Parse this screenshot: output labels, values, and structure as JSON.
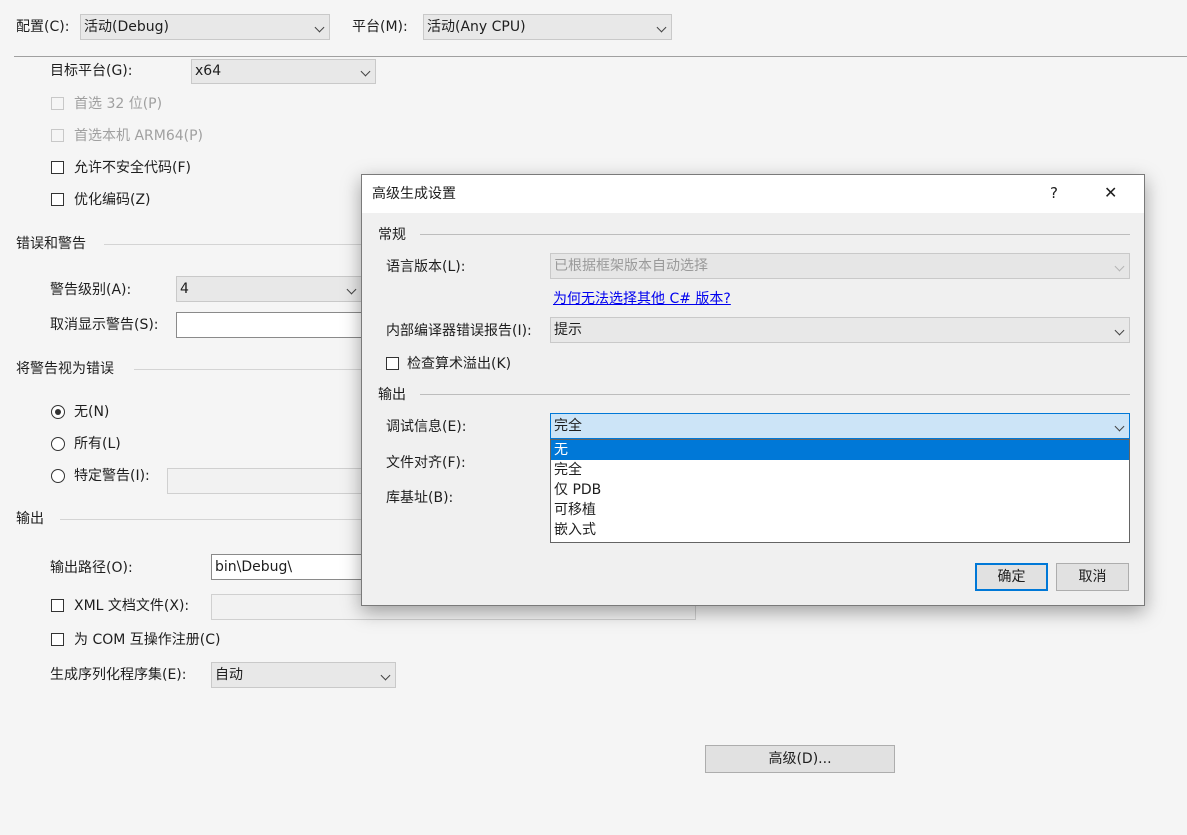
{
  "top": {
    "config_label": "配置(C):",
    "config_value": "活动(Debug)",
    "platform_label": "平台(M):",
    "platform_value": "活动(Any CPU)"
  },
  "general": {
    "target_platform_label": "目标平台(G):",
    "target_platform_value": "x64",
    "prefer32_label": "首选 32 位(P)",
    "prefer_arm64_label": "首选本机 ARM64(P)",
    "unsafe_label": "允许不安全代码(F)",
    "optimize_label": "优化编码(Z)"
  },
  "errors": {
    "section_title": "错误和警告",
    "warning_level_label": "警告级别(A):",
    "warning_level_value": "4",
    "suppress_label": "取消显示警告(S):",
    "suppress_value": ""
  },
  "treat_warnings": {
    "section_title": "将警告视为错误",
    "none_label": "无(N)",
    "all_label": "所有(L)",
    "specific_label": "特定警告(I):"
  },
  "output": {
    "section_title": "输出",
    "path_label": "输出路径(O):",
    "path_value": "bin\\Debug\\",
    "xml_label": "XML 文档文件(X):",
    "com_label": "为 COM 互操作注册(C)",
    "serialization_label": "生成序列化程序集(E):",
    "serialization_value": "自动",
    "advanced_button": "高级(D)..."
  },
  "dialog": {
    "title": "高级生成设置",
    "help": "?",
    "close": "✕",
    "general_section": "常规",
    "lang_version_label": "语言版本(L):",
    "lang_version_value": "已根据框架版本自动选择",
    "why_link": "为何无法选择其他 C# 版本?",
    "ice_label": "内部编译器错误报告(I):",
    "ice_value": "提示",
    "overflow_label": "检查算术溢出(K)",
    "output_section": "输出",
    "debug_info_label": "调试信息(E):",
    "debug_info_value": "完全",
    "file_align_label": "文件对齐(F):",
    "base_addr_label": "库基址(B):",
    "dropdown_options": [
      "无",
      "完全",
      "仅 PDB",
      "可移植",
      "嵌入式"
    ],
    "ok_button": "确定",
    "cancel_button": "取消"
  },
  "colors": {
    "accent": "#0078d7",
    "link": "#0000ee",
    "background": "#f5f5f5"
  }
}
